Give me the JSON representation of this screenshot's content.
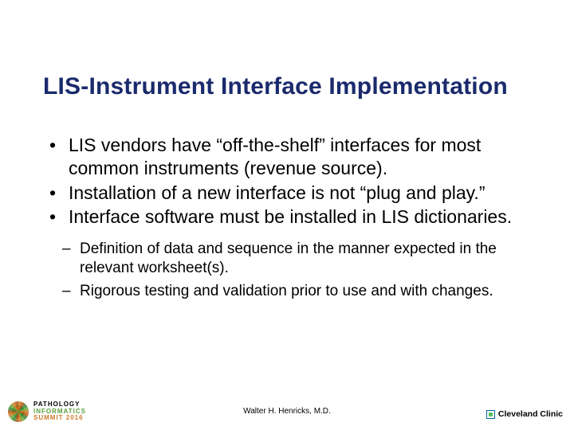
{
  "title": "LIS-Instrument Interface Implementation",
  "bullets": {
    "b1": "LIS vendors have “off-the-shelf” interfaces for most common instruments (revenue source).",
    "b2": "Installation of a new interface is not “plug and play.”",
    "b3": "Interface software must be installed in LIS dictionaries."
  },
  "subbullets": {
    "s1": "Definition of data and sequence in the manner expected in the relevant worksheet(s).",
    "s2": "Rigorous testing and validation prior to use and with changes."
  },
  "footer": {
    "author": "Walter H. Henricks, M.D.",
    "left_l1": "PATHOLOGY",
    "left_l2": "INFORMATICS",
    "left_l3": "SUMMIT 2016",
    "right": "Cleveland Clinic"
  }
}
